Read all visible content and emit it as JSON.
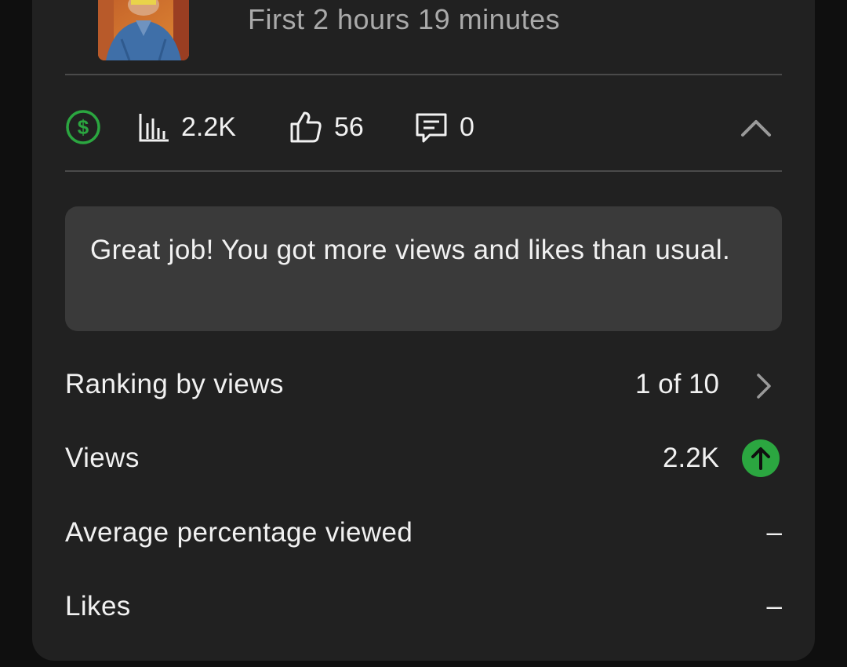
{
  "video": {
    "subtitle": "First 2 hours 19 minutes"
  },
  "stats": {
    "views": "2.2K",
    "likes": "56",
    "comments": "0"
  },
  "banner": {
    "message": "Great job! You got more views and likes than usual."
  },
  "metrics": [
    {
      "label": "Ranking by views",
      "value": "1 of 10"
    },
    {
      "label": "Views",
      "value": "2.2K"
    },
    {
      "label": "Average percentage viewed",
      "value": "–"
    },
    {
      "label": "Likes",
      "value": "–"
    }
  ],
  "colors": {
    "accent_green": "#2ba640",
    "card_bg": "#212121",
    "banner_bg": "#3a3a3a"
  },
  "icons": {
    "monetization": "dollar-circle-icon",
    "views": "bar-chart-icon",
    "likes": "thumbs-up-icon",
    "comments": "comment-icon",
    "collapse": "chevron-up-icon",
    "trend": "arrow-up-icon"
  }
}
